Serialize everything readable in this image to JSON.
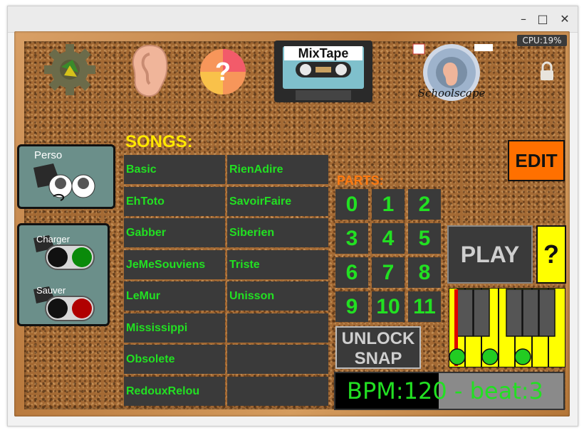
{
  "window": {
    "controls": {
      "minimize": "–",
      "maximize": "□",
      "close": "✕"
    },
    "cpu_label": "CPU:19%"
  },
  "top_icons": {
    "gear": "gear-icon",
    "ear": "ear-icon",
    "help": "question-icon",
    "mixtape_label": "MixTape",
    "schoolscape_label": "Schoolscape",
    "lock": "lock-icon"
  },
  "sidebar": {
    "perso_label": "Perso",
    "charger_label": "Charger",
    "sauver_label": "Sauver",
    "charger_color": "#0a8a0a",
    "sauver_color": "#b00000"
  },
  "songs": {
    "title": "SONGS:",
    "left": [
      "Basic",
      "EhToto",
      "Gabber",
      "JeMeSouviens",
      "LeMur",
      "Mississippi",
      "Obsolete",
      "RedouxRelou"
    ],
    "right": [
      "RienAdire",
      "SavoirFaire",
      "Siberien",
      "Triste",
      "Unisson",
      "",
      "",
      ""
    ]
  },
  "parts": {
    "title": "PARTS:",
    "buttons": [
      "0",
      "1",
      "2",
      "3",
      "4",
      "5",
      "6",
      "7",
      "8",
      "9",
      "10",
      "11"
    ]
  },
  "controls": {
    "edit_label": "EDIT",
    "play_label": "PLAY",
    "help_label": "?",
    "unlock_line1": "UNLOCK",
    "unlock_line2": "SNAP",
    "bpm_text": "BPM:120 - beat:3"
  },
  "colors": {
    "text_green": "#22e022",
    "songs_title": "#ffe800",
    "parts_title": "#ff7a10",
    "edit_bg": "#ff7000",
    "help_bg": "#ffff00",
    "piano_yellow": "#ffff00"
  }
}
